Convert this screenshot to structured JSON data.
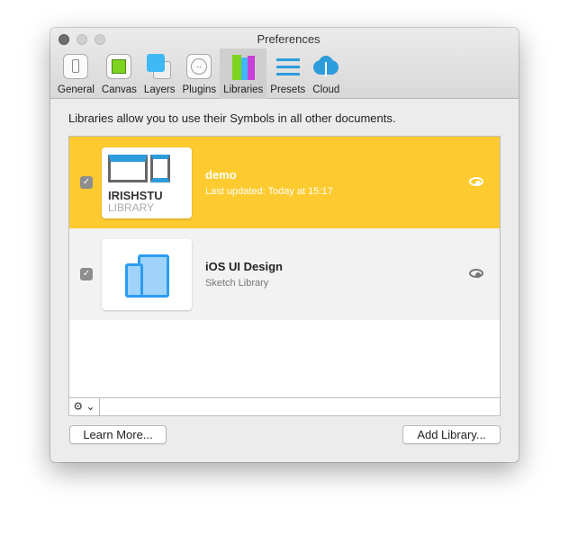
{
  "window": {
    "title": "Preferences"
  },
  "tabs": [
    {
      "label": "General",
      "icon": "general-icon"
    },
    {
      "label": "Canvas",
      "icon": "canvas-icon"
    },
    {
      "label": "Layers",
      "icon": "layers-icon"
    },
    {
      "label": "Plugins",
      "icon": "plugins-icon"
    },
    {
      "label": "Libraries",
      "icon": "libraries-icon",
      "active": true
    },
    {
      "label": "Presets",
      "icon": "presets-icon"
    },
    {
      "label": "Cloud",
      "icon": "cloud-icon"
    }
  ],
  "description": "Libraries allow you to use their Symbols in all other documents.",
  "libraries": [
    {
      "name": "demo",
      "subtitle": "Last updated: Today at 15:17",
      "checked": true,
      "selected": true,
      "thumb_title": "IRISHSTU",
      "thumb_sub": "LIBRARY"
    },
    {
      "name": "iOS UI Design",
      "subtitle": "Sketch Library",
      "checked": true,
      "selected": false
    }
  ],
  "colors": {
    "selected": "#fdca2f",
    "accent": "#2d9cdb"
  },
  "buttons": {
    "learn_more": "Learn More...",
    "add_library": "Add Library..."
  },
  "gear_menu": "⚙ ⌄"
}
